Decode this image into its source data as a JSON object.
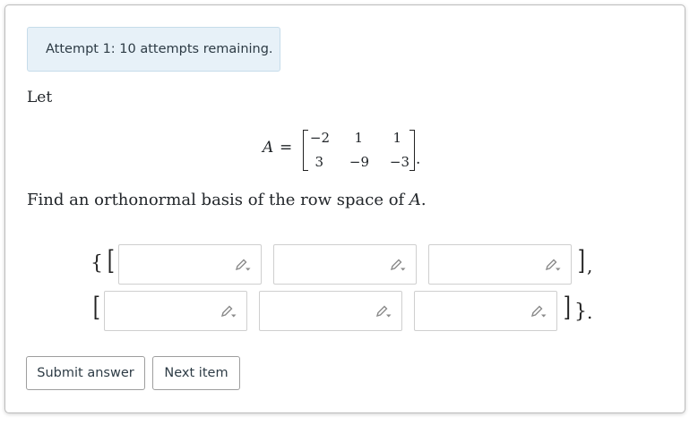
{
  "alert": {
    "text": "Attempt 1: 10 attempts remaining."
  },
  "problem": {
    "intro": "Let",
    "matrix_name": "A",
    "equals": "=",
    "matrix": [
      [
        "−2",
        "1",
        "1"
      ],
      [
        "3",
        "−9",
        "−3"
      ]
    ],
    "end_period": ".",
    "question_prefix": "Find an orthonormal basis of the row space of ",
    "question_var": "A",
    "question_suffix": "."
  },
  "answer": {
    "open_brace": "{",
    "close_brace": "}",
    "open_bracket": "[",
    "close_bracket": "]",
    "separator": ",",
    "end_period": ".",
    "vectors": [
      {
        "inputs": [
          {
            "value": ""
          },
          {
            "value": ""
          },
          {
            "value": ""
          }
        ]
      },
      {
        "inputs": [
          {
            "value": ""
          },
          {
            "value": ""
          },
          {
            "value": ""
          }
        ]
      }
    ],
    "input_icon": "pencil-icon"
  },
  "buttons": {
    "submit_label": "Submit answer",
    "next_label": "Next item"
  },
  "colors": {
    "alert_background": "#e7f1f8",
    "alert_border": "#c6dcea",
    "text": "#212529",
    "button_border": "#9e9e9e"
  }
}
